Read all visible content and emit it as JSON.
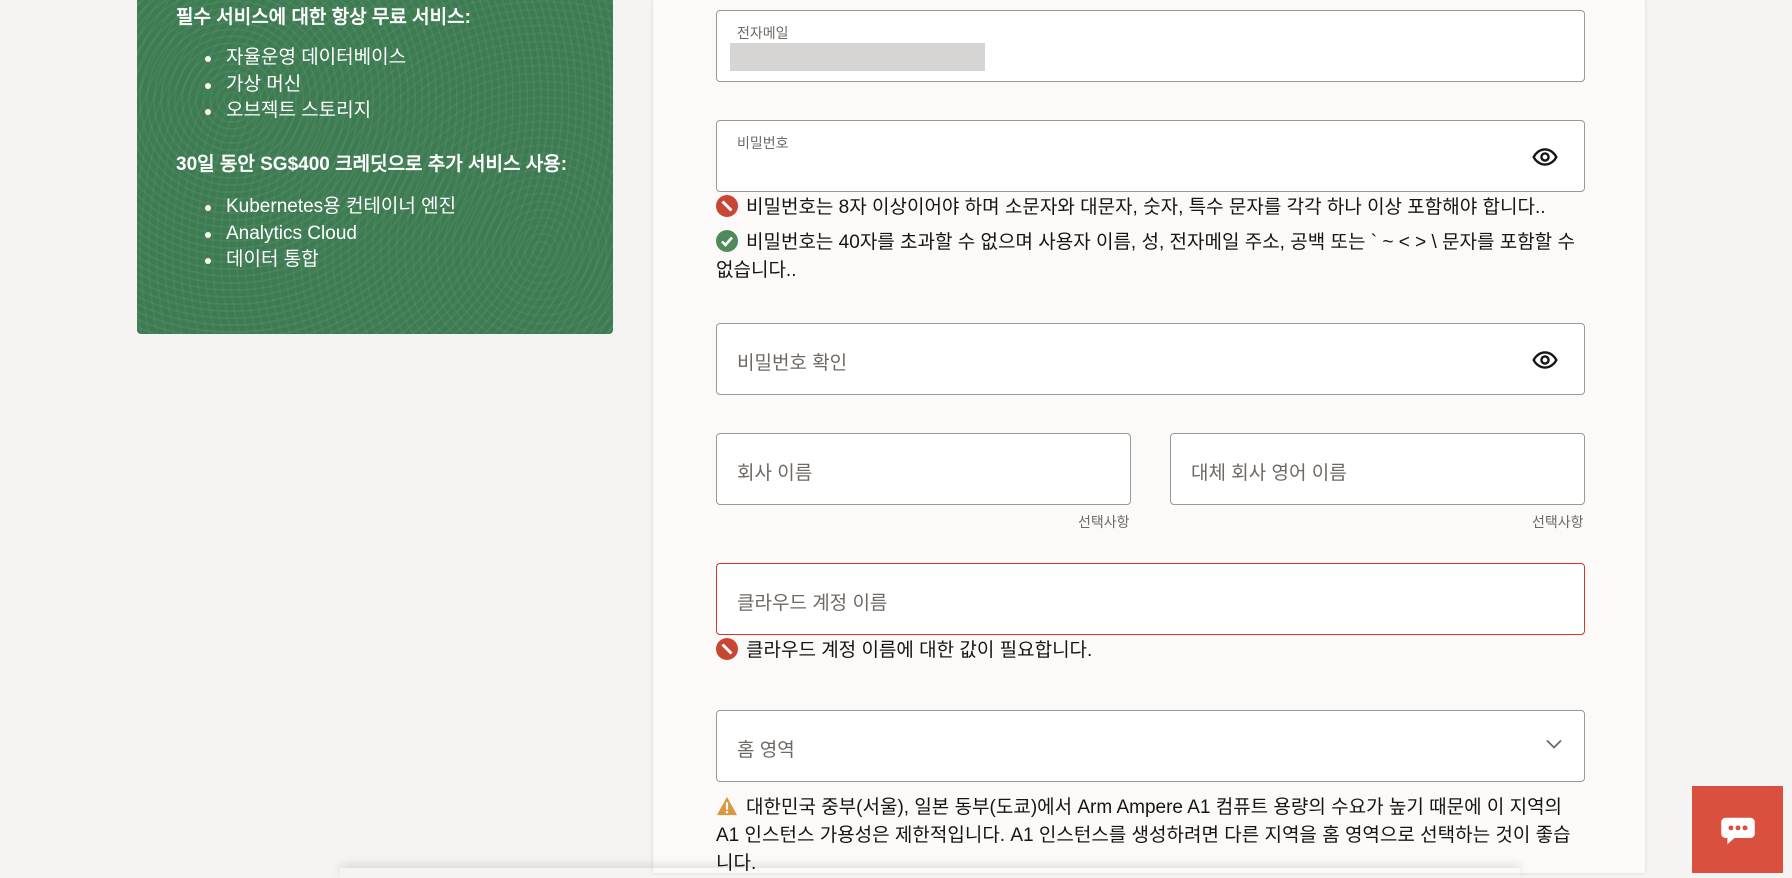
{
  "promo": {
    "always_free_heading": "필수 서비스에 대한 항상 무료 서비스:",
    "always_free_items": [
      "자율운영 데이터베이스",
      "가상 머신",
      "오브젝트 스토리지"
    ],
    "credit_heading": "30일 동안 SG$400 크레딧으로 추가 서비스 사용:",
    "credit_items": [
      "Kubernetes용 컨테이너 엔진",
      "Analytics Cloud",
      "데이터 통합"
    ]
  },
  "form": {
    "email": {
      "label": "전자메일"
    },
    "password": {
      "label": "비밀번호",
      "rule_error": "비밀번호는 8자 이상이어야 하며 소문자와 대문자, 숫자, 특수 문자를 각각 하나 이상 포함해야 합니다..",
      "rule_ok": "비밀번호는 40자를 초과할 수 없으며 사용자 이름, 성, 전자메일 주소, 공백 또는 ` ~ < > \\ 문자를 포함할 수 없습니다.."
    },
    "confirm_password": {
      "placeholder": "비밀번호 확인"
    },
    "company_name": {
      "placeholder": "회사 이름",
      "hint": "선택사항"
    },
    "alt_company_name": {
      "placeholder": "대체 회사 영어 이름",
      "hint": "선택사항"
    },
    "cloud_account": {
      "placeholder": "클라우드 계정 이름",
      "error": "클라우드 계정 이름에 대한 값이 필요합니다."
    },
    "home_region": {
      "placeholder": "홈 영역",
      "warning": "대한민국 중부(서울), 일본 동부(도쿄)에서 Arm Ampere A1 컴퓨트 용량의 수요가 높기 때문에 이 지역의 A1 인스턴스 가용성은 제한적입니다. A1 인스턴스를 생성하려면 다른 지역을 홈 영역으로 선택하는 것이 좋습니다."
    }
  },
  "colors": {
    "promo_green": "#3d7b52",
    "error_red": "#d0382b",
    "success_green": "#508a5c",
    "warning_orange": "#d9973f",
    "chat_red": "#d9503f"
  },
  "icons": [
    "eye-icon",
    "error-icon",
    "check-icon",
    "warning-icon",
    "chevron-down-icon",
    "chat-icon"
  ]
}
